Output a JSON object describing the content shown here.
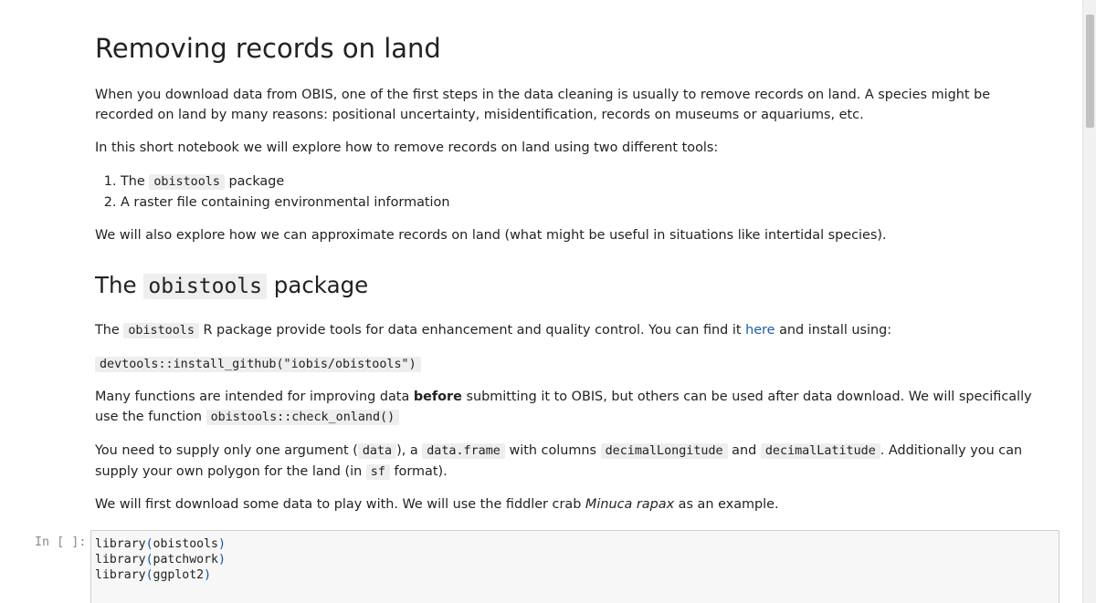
{
  "heading1": "Removing records on land",
  "intro": {
    "p1": "When you download data from OBIS, one of the first steps in the data cleaning is usually to remove records on land. A species might be recorded on land by many reasons: positional uncertainty, misidentification, records on museums or aquariums, etc.",
    "p2": "In this short notebook we will explore how to remove records on land using two different tools:",
    "list": {
      "item1_pre": "The ",
      "item1_code": "obistools",
      "item1_post": " package",
      "item2": "A raster file containing environmental information"
    },
    "p3": "We will also explore how we can approximate records on land (what might be useful in situations like intertidal species)."
  },
  "heading2": {
    "pre": "The ",
    "code": "obistools",
    "post": " package"
  },
  "section": {
    "p1_pre": "The ",
    "p1_code": "obistools",
    "p1_mid": " R package provide tools for data enhancement and quality control. You can find it ",
    "p1_link": "here",
    "p1_post": " and install using:",
    "install_code": "devtools::install_github(\"iobis/obistools\")",
    "p2_pre": "Many functions are intended for improving data ",
    "p2_bold": "before",
    "p2_mid": " submitting it to OBIS, but others can be used after data download. We will specifically use the function ",
    "p2_code": "obistools::check_onland()",
    "p3_pre": "You need to supply only one argument (",
    "p3_code1": "data",
    "p3_mid1": "), a ",
    "p3_code2": "data.frame",
    "p3_mid2": " with columns ",
    "p3_code3": "decimalLongitude",
    "p3_mid3": " and ",
    "p3_code4": "decimalLatitude",
    "p3_mid4": ". Additionally you can supply your own polygon for the land (in ",
    "p3_code5": "sf",
    "p3_post": " format).",
    "p4_pre": "We will first download some data to play with. We will use the fiddler crab ",
    "p4_italic": "Minuca rapax",
    "p4_post": " as an example."
  },
  "code_cell": {
    "prompt": "In [ ]:",
    "lines": [
      {
        "fn": "library",
        "arg": "obistools"
      },
      {
        "fn": "library",
        "arg": "patchwork"
      },
      {
        "fn": "library",
        "arg": "ggplot2"
      }
    ]
  }
}
